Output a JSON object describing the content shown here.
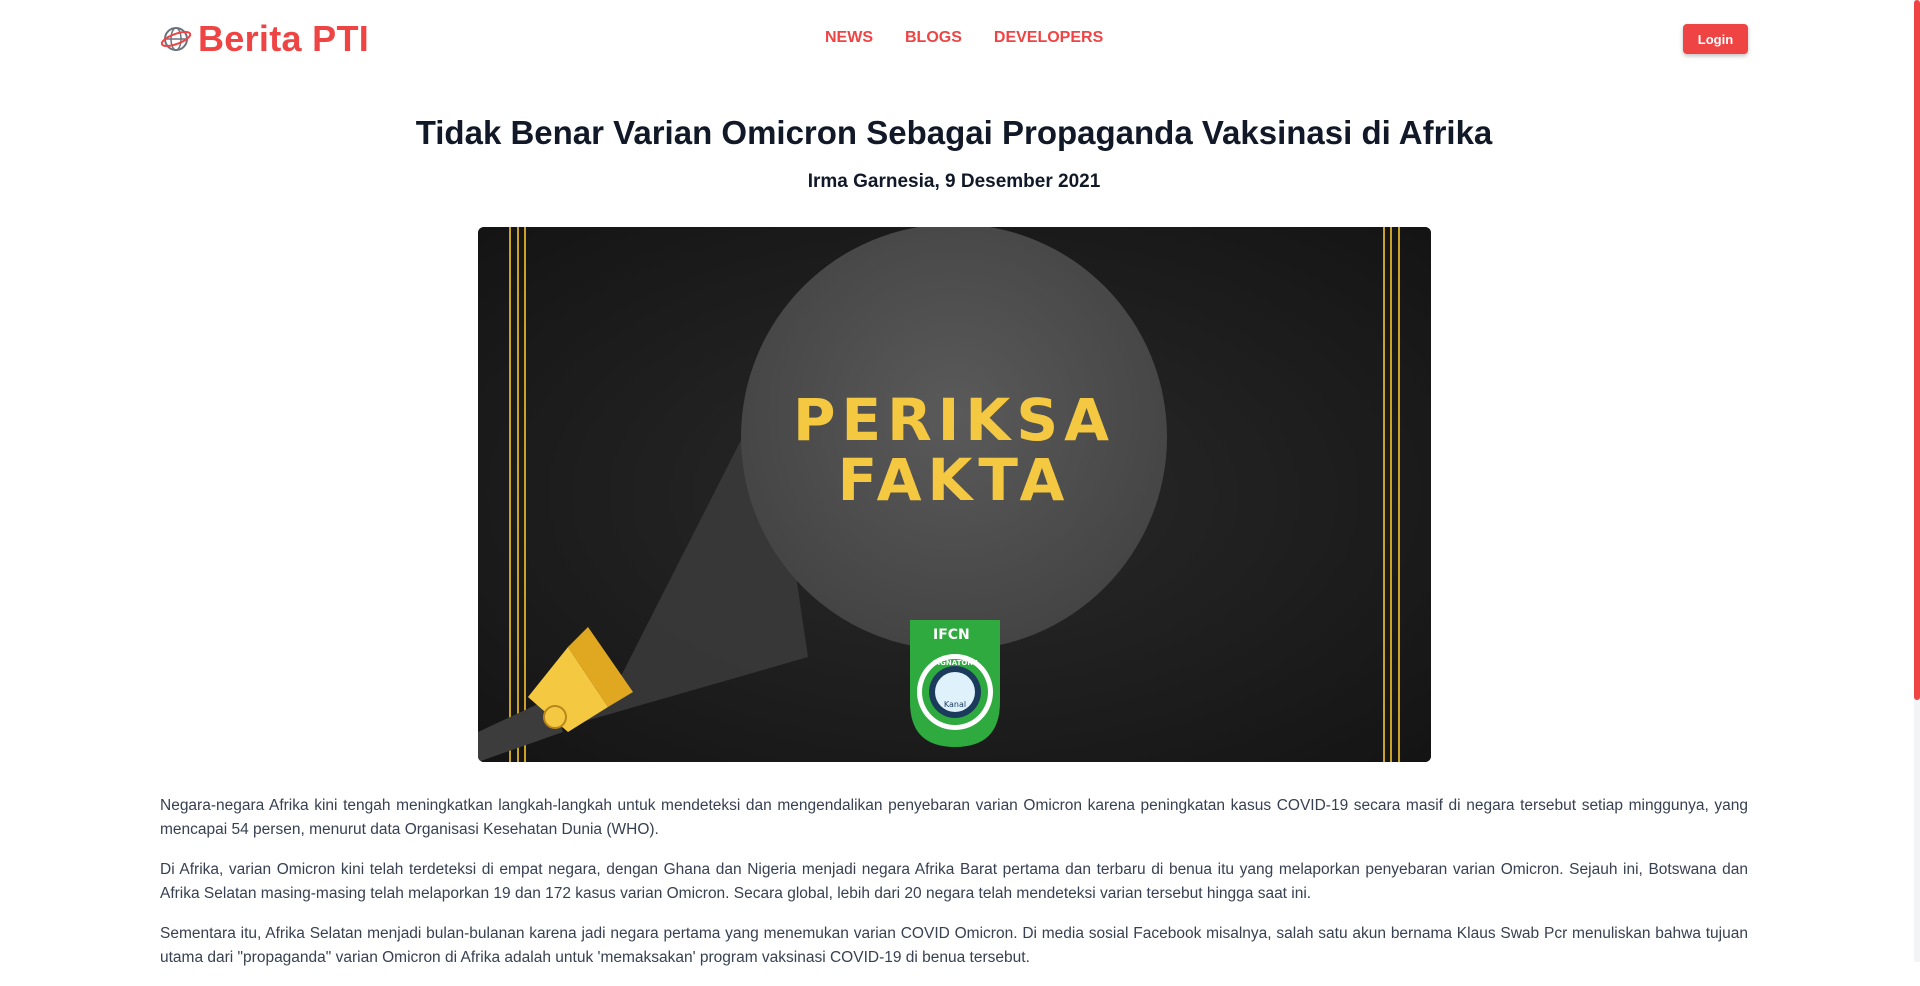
{
  "header": {
    "brand": "Berita PTI",
    "nav": [
      {
        "label": "NEWS"
      },
      {
        "label": "BLOGS"
      },
      {
        "label": "DEVELOPERS"
      }
    ],
    "login_label": "Login"
  },
  "article": {
    "title": "Tidak Benar Varian Omicron Sebagai Propaganda Vaksinasi di Afrika",
    "byline": "Irma Garnesia, 9 Desember 2021",
    "image": {
      "line1": "PERIKSA",
      "line2": "FAKTA",
      "badge_top": "IFCN",
      "badge_ring": "SIGNATORY",
      "badge_center": "Kanal"
    },
    "paragraphs": [
      "Negara-negara Afrika kini tengah meningkatkan langkah-langkah untuk mendeteksi dan mengendalikan penyebaran varian Omicron karena peningkatan kasus COVID-19 secara masif di negara tersebut setiap minggunya, yang mencapai 54 persen, menurut data Organisasi Kesehatan Dunia (WHO).",
      "Di Afrika, varian Omicron kini telah terdeteksi di empat negara, dengan Ghana dan Nigeria menjadi negara Afrika Barat pertama dan terbaru di benua itu yang melaporkan penyebaran varian Omicron. Sejauh ini, Botswana dan Afrika Selatan masing-masing telah melaporkan 19 dan 172 kasus varian Omicron. Secara global, lebih dari 20 negara telah mendeteksi varian tersebut hingga saat ini.",
      "Sementara itu, Afrika Selatan menjadi bulan-bulanan karena jadi negara pertama yang menemukan varian COVID Omicron. Di media sosial Facebook misalnya, salah satu akun bernama Klaus Swab Pcr menuliskan bahwa tujuan utama dari \"propaganda\" varian Omicron di Afrika adalah untuk 'memaksakan' program vaksinasi COVID-19 di benua tersebut."
    ]
  },
  "colors": {
    "accent": "#ef4444",
    "hero_text": "#f5c842",
    "badge_green": "#2eaa3f"
  }
}
